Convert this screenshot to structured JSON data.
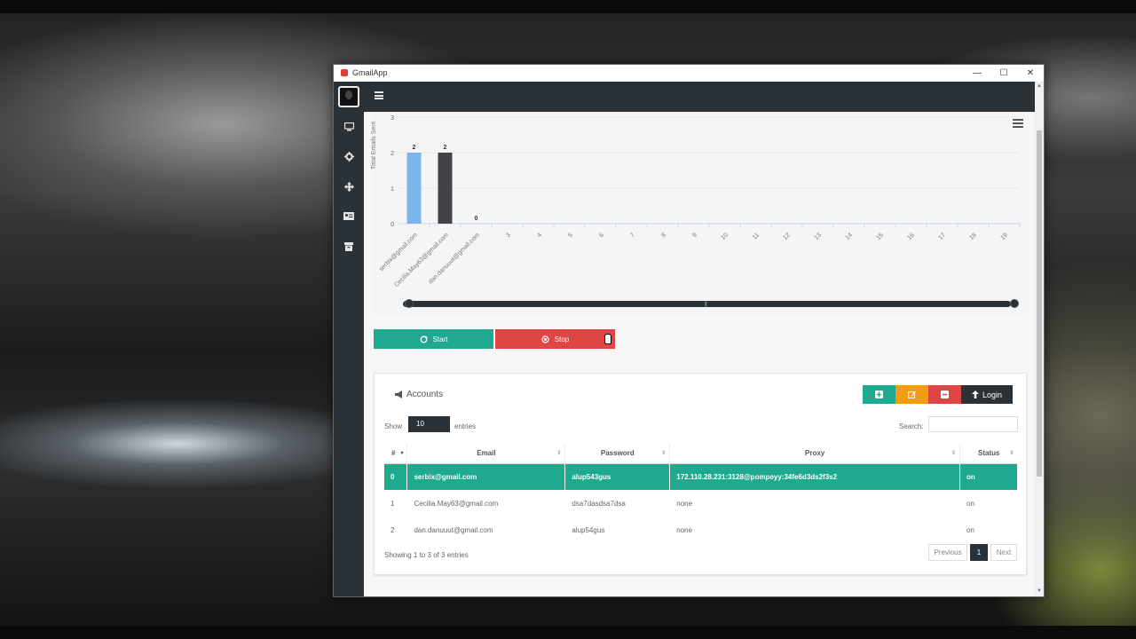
{
  "window": {
    "title": "GmailApp",
    "controls": {
      "minimize": "—",
      "maximize": "☐",
      "close": "✕"
    }
  },
  "sidebar": {
    "items": [
      {
        "icon": "monitor-icon"
      },
      {
        "icon": "gear-icon"
      },
      {
        "icon": "move-icon"
      },
      {
        "icon": "id-card-icon"
      },
      {
        "icon": "archive-icon"
      }
    ]
  },
  "chart_data": {
    "type": "bar",
    "ylabel": "Total Emails Sent",
    "ylim": [
      0,
      3
    ],
    "yticks": [
      "0",
      "1",
      "2",
      "3"
    ],
    "categories": [
      "serbix@gmail.com",
      "Cecilia.May63@gmail.com",
      "dan.danuuut@gmail.com",
      "3",
      "4",
      "5",
      "6",
      "7",
      "8",
      "9",
      "10",
      "11",
      "12",
      "13",
      "14",
      "15",
      "16",
      "17",
      "18",
      "19"
    ],
    "values": [
      2,
      2,
      0
    ],
    "data_labels": [
      "2",
      "2",
      "0"
    ],
    "bar_colors": [
      "#7cb5ec",
      "#434348",
      "#90ed7d"
    ]
  },
  "controls": {
    "start_label": "Start",
    "stop_label": "Stop"
  },
  "accounts": {
    "title": "Accounts",
    "toolbar": {
      "add_color": "#1fa98f",
      "edit_color": "#f39c12",
      "delete_color": "#e04545",
      "login_label": "Login",
      "login_color": "#2a3238"
    },
    "show_label": "Show",
    "page_length": "10",
    "entries_label": "entries",
    "search_label": "Search:",
    "columns": [
      "#",
      "Email",
      "Password",
      "Proxy",
      "Status"
    ],
    "rows": [
      {
        "num": "0",
        "email": "serbix@gmail.com",
        "password": "alup543gus",
        "proxy": "172.110.28.231:3128@pompeyy:34fe6d3ds2f3s2",
        "status": "on",
        "selected": true
      },
      {
        "num": "1",
        "email": "Cecilia.May63@gmail.com",
        "password": "dsa7dasdsa7dsa",
        "proxy": "none",
        "status": "on",
        "selected": false
      },
      {
        "num": "2",
        "email": "dan.danuuut@gmail.com",
        "password": "alup54gus",
        "proxy": "none",
        "status": "on",
        "selected": false
      }
    ],
    "info": "Showing 1 to 3 of 3 entries",
    "pagination": {
      "previous": "Previous",
      "current": "1",
      "next": "Next"
    }
  }
}
